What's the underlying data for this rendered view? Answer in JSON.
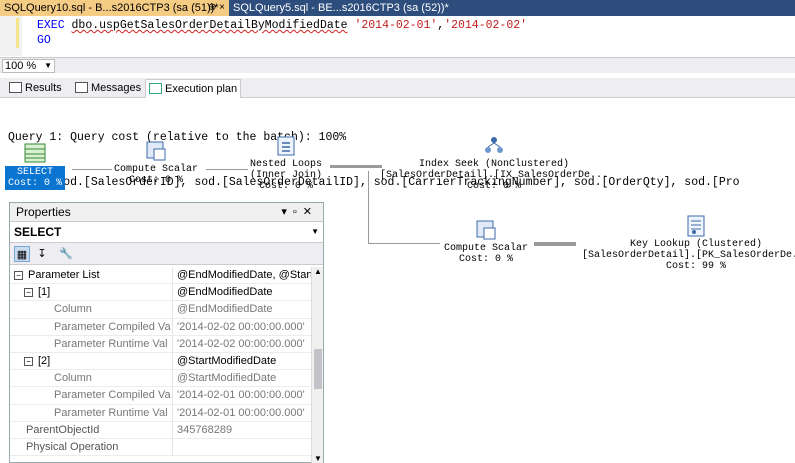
{
  "tabs": {
    "active": "SQLQuery10.sql - B...s2016CTP3 (sa (51))*",
    "active_icons": "⊕ ×",
    "inactive": "SQLQuery5.sql - BE...s2016CTP3 (sa (52))*"
  },
  "editor": {
    "line1_kw": "EXEC",
    "line1_proc": "dbo.uspGetSalesOrderDetailByModifiedDate",
    "line1_arg1": "'2014-02-01'",
    "line1_comma": ",",
    "line1_arg2": "'2014-02-02'",
    "line2_kw": "GO"
  },
  "zoom": {
    "value": "100 %"
  },
  "result_tabs": {
    "results": "Results",
    "messages": "Messages",
    "plan": "Execution plan"
  },
  "query": {
    "cost_line": "Query 1: Query cost (relative to the batch): 100%",
    "sql_line": "SELECT sod.[SalesOrderID], sod.[SalesOrderDetailID], sod.[CarrierTrackingNumber], sod.[OrderQty], sod.[Pro"
  },
  "plan": {
    "select": {
      "name": "SELECT",
      "cost": "Cost: 0 %"
    },
    "compute1": {
      "name": "Compute Scalar",
      "cost": "Cost: 0 %"
    },
    "nested": {
      "name": "Nested Loops",
      "sub": "(Inner Join)",
      "cost": "Cost: 0 %"
    },
    "seek": {
      "name": "Index Seek (NonClustered)",
      "sub": "[SalesOrderDetail].[IX_SalesOrderDe...",
      "cost": "Cost: 0 %"
    },
    "compute2": {
      "name": "Compute Scalar",
      "cost": "Cost: 0 %"
    },
    "lookup": {
      "name": "Key Lookup (Clustered)",
      "sub": "[SalesOrderDetail].[PK_SalesOrderDe...",
      "cost": "Cost: 99 %"
    }
  },
  "properties": {
    "title": "Properties",
    "object": "SELECT",
    "rows": [
      {
        "name": "Parameter List",
        "value": "@EndModifiedDate, @StartM"
      },
      {
        "name": "[1]",
        "value": "@EndModifiedDate"
      },
      {
        "name": "Column",
        "value": "@EndModifiedDate"
      },
      {
        "name": "Parameter Compiled Va",
        "value": "'2014-02-02 00:00:00.000'"
      },
      {
        "name": "Parameter Runtime Val",
        "value": "'2014-02-02 00:00:00.000'"
      },
      {
        "name": "[2]",
        "value": "@StartModifiedDate"
      },
      {
        "name": "Column",
        "value": "@StartModifiedDate"
      },
      {
        "name": "Parameter Compiled Va",
        "value": "'2014-02-01 00:00:00.000'"
      },
      {
        "name": "Parameter Runtime Val",
        "value": "'2014-02-01 00:00:00.000'"
      },
      {
        "name": "ParentObjectId",
        "value": "345768289"
      },
      {
        "name": "Physical Operation",
        "value": ""
      }
    ]
  }
}
